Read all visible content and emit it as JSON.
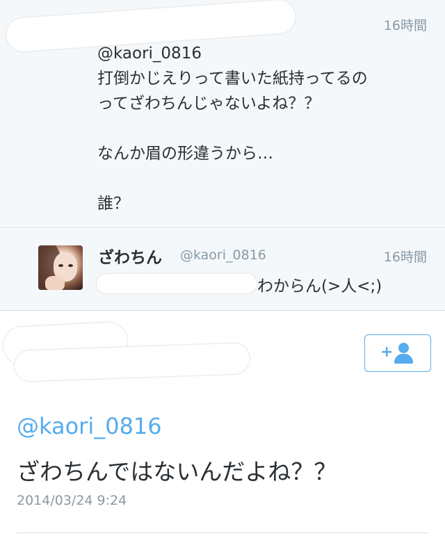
{
  "tweet1": {
    "time": "16時間",
    "body": "@kaori_0816\n打倒かじえりって書いた紙持ってるの\nってざわちんじゃないよね？？\n\nなんか眉の形違うから…\n\n誰？"
  },
  "tweet2": {
    "name": "ざわちん",
    "handle": "@kaori_0816",
    "time": "16時間",
    "reply_text": "わからん(>人<;)"
  },
  "detail": {
    "mention": "@kaori_0816",
    "text": "ざわちんではないんだよね？？",
    "date": "2014/03/24 9:24",
    "follow_icon": "add-user-icon"
  },
  "colors": {
    "accent": "#55acee",
    "muted": "#8899a6",
    "text": "#292f33",
    "panel_bg": "#f5f8fa"
  }
}
